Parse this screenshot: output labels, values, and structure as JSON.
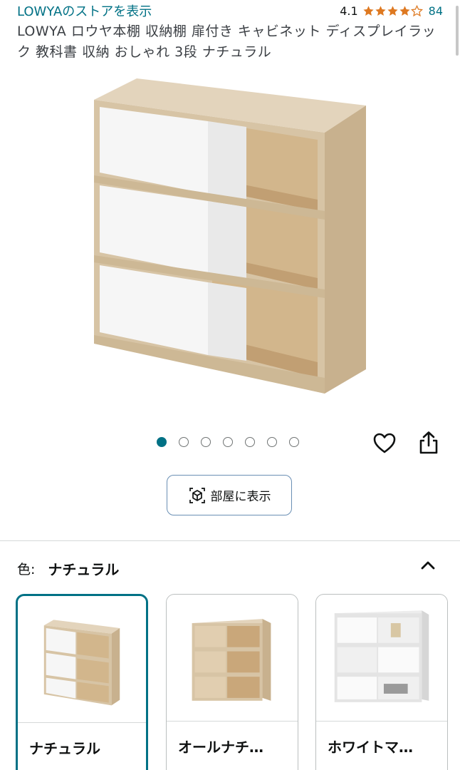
{
  "header": {
    "store_link": "LOWYAのストアを表示",
    "rating_value": "4.1",
    "rating_stars": 4.1,
    "review_count": "84"
  },
  "product": {
    "title": "LOWYA ロウヤ本棚 収納棚 扉付き キャビネット ディスプレイラック 教科書 収納 おしゃれ 3段 ナチュラル"
  },
  "gallery": {
    "image_count": 7,
    "active_index": 0,
    "favorite_icon": "heart-outline-icon",
    "share_icon": "share-icon"
  },
  "room_button": {
    "label": "部屋に表示",
    "icon": "ar-cube-icon"
  },
  "color_selector": {
    "label": "色:",
    "selected": "ナチュラル",
    "collapse_icon": "chevron-up-icon",
    "options": [
      {
        "name": "ナチュラル",
        "selected": true
      },
      {
        "name": "オールナチ…",
        "selected": false
      },
      {
        "name": "ホワイトマ…",
        "selected": false
      }
    ]
  },
  "colors": {
    "link": "#007185",
    "accent": "#007185",
    "star": "#de7921",
    "wood": "#d9c6a8",
    "white_panel": "#f6f6f6"
  }
}
